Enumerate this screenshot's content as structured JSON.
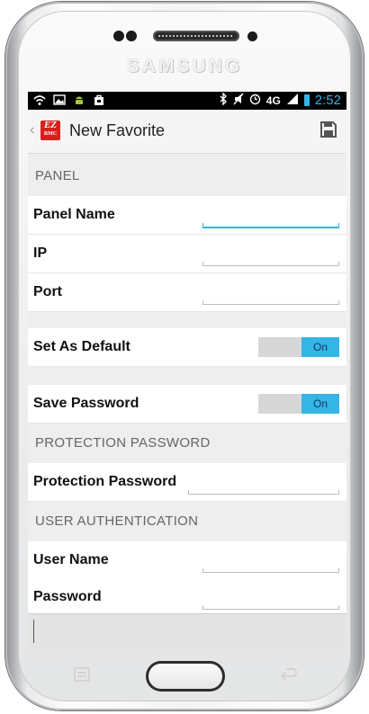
{
  "device": {
    "brand": "SAMSUNG"
  },
  "statusbar": {
    "time": "2:52",
    "network": "4G",
    "left_icons": [
      "wifi-icon",
      "picture-icon",
      "android-icon",
      "shopping-bag-icon"
    ],
    "right_icons": [
      "bluetooth-icon",
      "mute-icon",
      "alarm-icon",
      "signal-icon",
      "battery-icon"
    ]
  },
  "actionbar": {
    "app_logo_top": "EZ",
    "app_logo_bottom": "RMC",
    "title": "New Favorite",
    "save_icon": "save-icon"
  },
  "sections": {
    "panel": {
      "header": "PANEL",
      "panel_name_label": "Panel Name",
      "ip_label": "IP",
      "port_label": "Port"
    },
    "set_default": {
      "label": "Set As Default",
      "toggle": "On"
    },
    "save_password": {
      "label": "Save Password",
      "toggle": "On"
    },
    "protection": {
      "header": "PROTECTION PASSWORD",
      "label": "Protection Password"
    },
    "user_auth": {
      "header": "USER AUTHENTICATION",
      "user_name_label": "User Name",
      "password_label": "Password"
    }
  },
  "colors": {
    "accent": "#33b5e5",
    "logo_red": "#d6201b",
    "section_bg": "#eeeeee"
  }
}
